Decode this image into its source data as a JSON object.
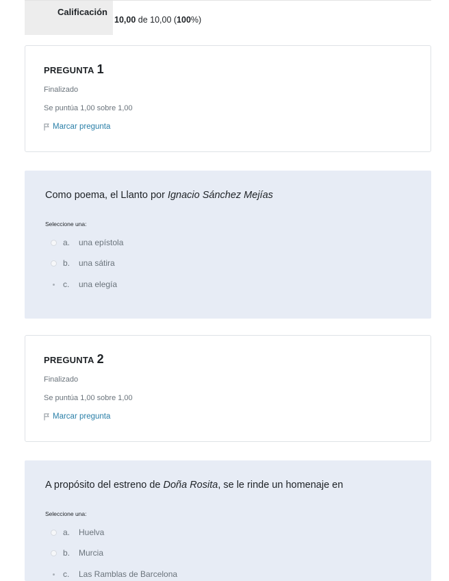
{
  "summary": {
    "label": "Calificación",
    "score": "10,00",
    "of_text": " de 10,00 (",
    "percent": "100",
    "percent_suffix": "%)"
  },
  "questions": [
    {
      "title": "PREGUNTA",
      "number": "1",
      "state": "Finalizado",
      "grade": "Se puntúa 1,00 sobre 1,00",
      "flag_label": "Marcar pregunta",
      "text_before": "Como poema, el Llanto por ",
      "text_italic": "Ignacio Sánchez Mejías",
      "text_after": "",
      "prompt": "Seleccione una:",
      "answers": [
        {
          "letter": "a.",
          "label": "una epístola",
          "checked": false
        },
        {
          "letter": "b.",
          "label": "una sátira",
          "checked": false
        },
        {
          "letter": "c.",
          "label": "una elegía",
          "checked": true
        }
      ]
    },
    {
      "title": "PREGUNTA",
      "number": "2",
      "state": "Finalizado",
      "grade": "Se puntúa 1,00 sobre 1,00",
      "flag_label": "Marcar pregunta",
      "text_before": "A propósito del estreno de ",
      "text_italic": "Doña Rosita",
      "text_after": ", se le rinde un homenaje en",
      "prompt": "Seleccione una:",
      "answers": [
        {
          "letter": "a.",
          "label": "Huelva",
          "checked": false
        },
        {
          "letter": "b.",
          "label": "Murcia",
          "checked": false
        },
        {
          "letter": "c.",
          "label": "Las Ramblas de Barcelona",
          "checked": true
        }
      ]
    }
  ],
  "icons": {
    "flag": "flag-icon"
  },
  "colors": {
    "link": "#2a7fa8",
    "panel_bg": "#e7ecf5",
    "muted_text": "#6a737b"
  }
}
